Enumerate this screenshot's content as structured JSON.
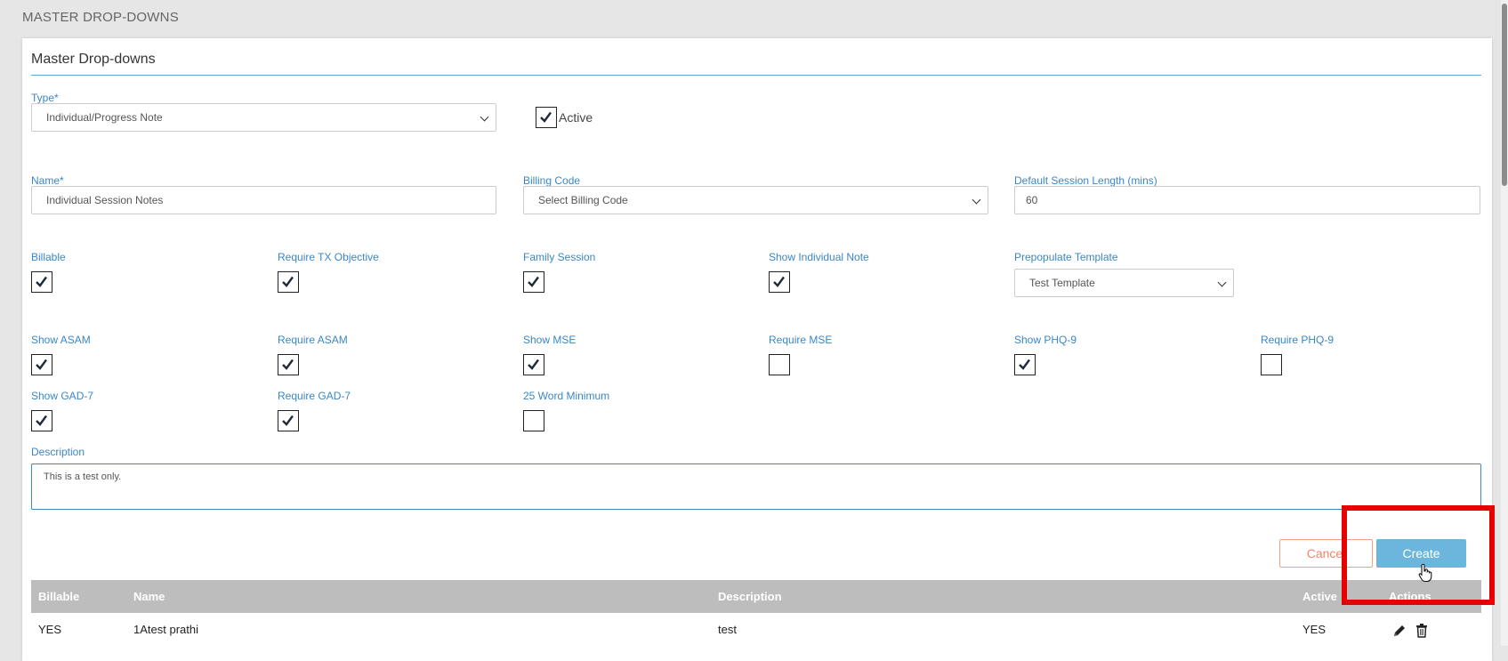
{
  "page_header": "MASTER DROP-DOWNS",
  "panel": {
    "title": "Master Drop-downs"
  },
  "form": {
    "type_label": "Type*",
    "type_value": "Individual/Progress Note",
    "active_label": "Active",
    "active_checked": true,
    "name_label": "Name*",
    "name_value": "Individual Session Notes",
    "billing_code_label": "Billing Code",
    "billing_code_value": "Select Billing Code",
    "session_length_label": "Default Session Length (mins)",
    "session_length_value": "60",
    "prepopulate_label": "Prepopulate Template",
    "prepopulate_value": "Test Template",
    "options": [
      {
        "label": "Billable",
        "checked": true
      },
      {
        "label": "Require TX Objective",
        "checked": true
      },
      {
        "label": "Family Session",
        "checked": true
      },
      {
        "label": "Show Individual Note",
        "checked": true
      },
      {
        "label": "Show ASAM",
        "checked": true
      },
      {
        "label": "Require ASAM",
        "checked": true
      },
      {
        "label": "Show MSE",
        "checked": true
      },
      {
        "label": "Require MSE",
        "checked": false
      },
      {
        "label": "Show PHQ-9",
        "checked": true
      },
      {
        "label": "Require PHQ-9",
        "checked": false
      },
      {
        "label": "Show GAD-7",
        "checked": true
      },
      {
        "label": "Require GAD-7",
        "checked": true
      },
      {
        "label": "25 Word Minimum",
        "checked": false
      }
    ],
    "description_label": "Description",
    "description_value": "This is a test only.",
    "cancel_label": "Cancel",
    "create_label": "Create"
  },
  "table": {
    "headers": [
      "Billable",
      "Name",
      "Description",
      "Active",
      "Actions"
    ],
    "rows": [
      {
        "billable": "YES",
        "name": "1Atest prathi",
        "description": "test",
        "active": "YES"
      }
    ]
  },
  "colors": {
    "accent": "#3a87c6",
    "create_button": "#6cb6de",
    "cancel_text": "#f1866b",
    "table_header": "#bdbdbd",
    "highlight": "#e60000"
  }
}
